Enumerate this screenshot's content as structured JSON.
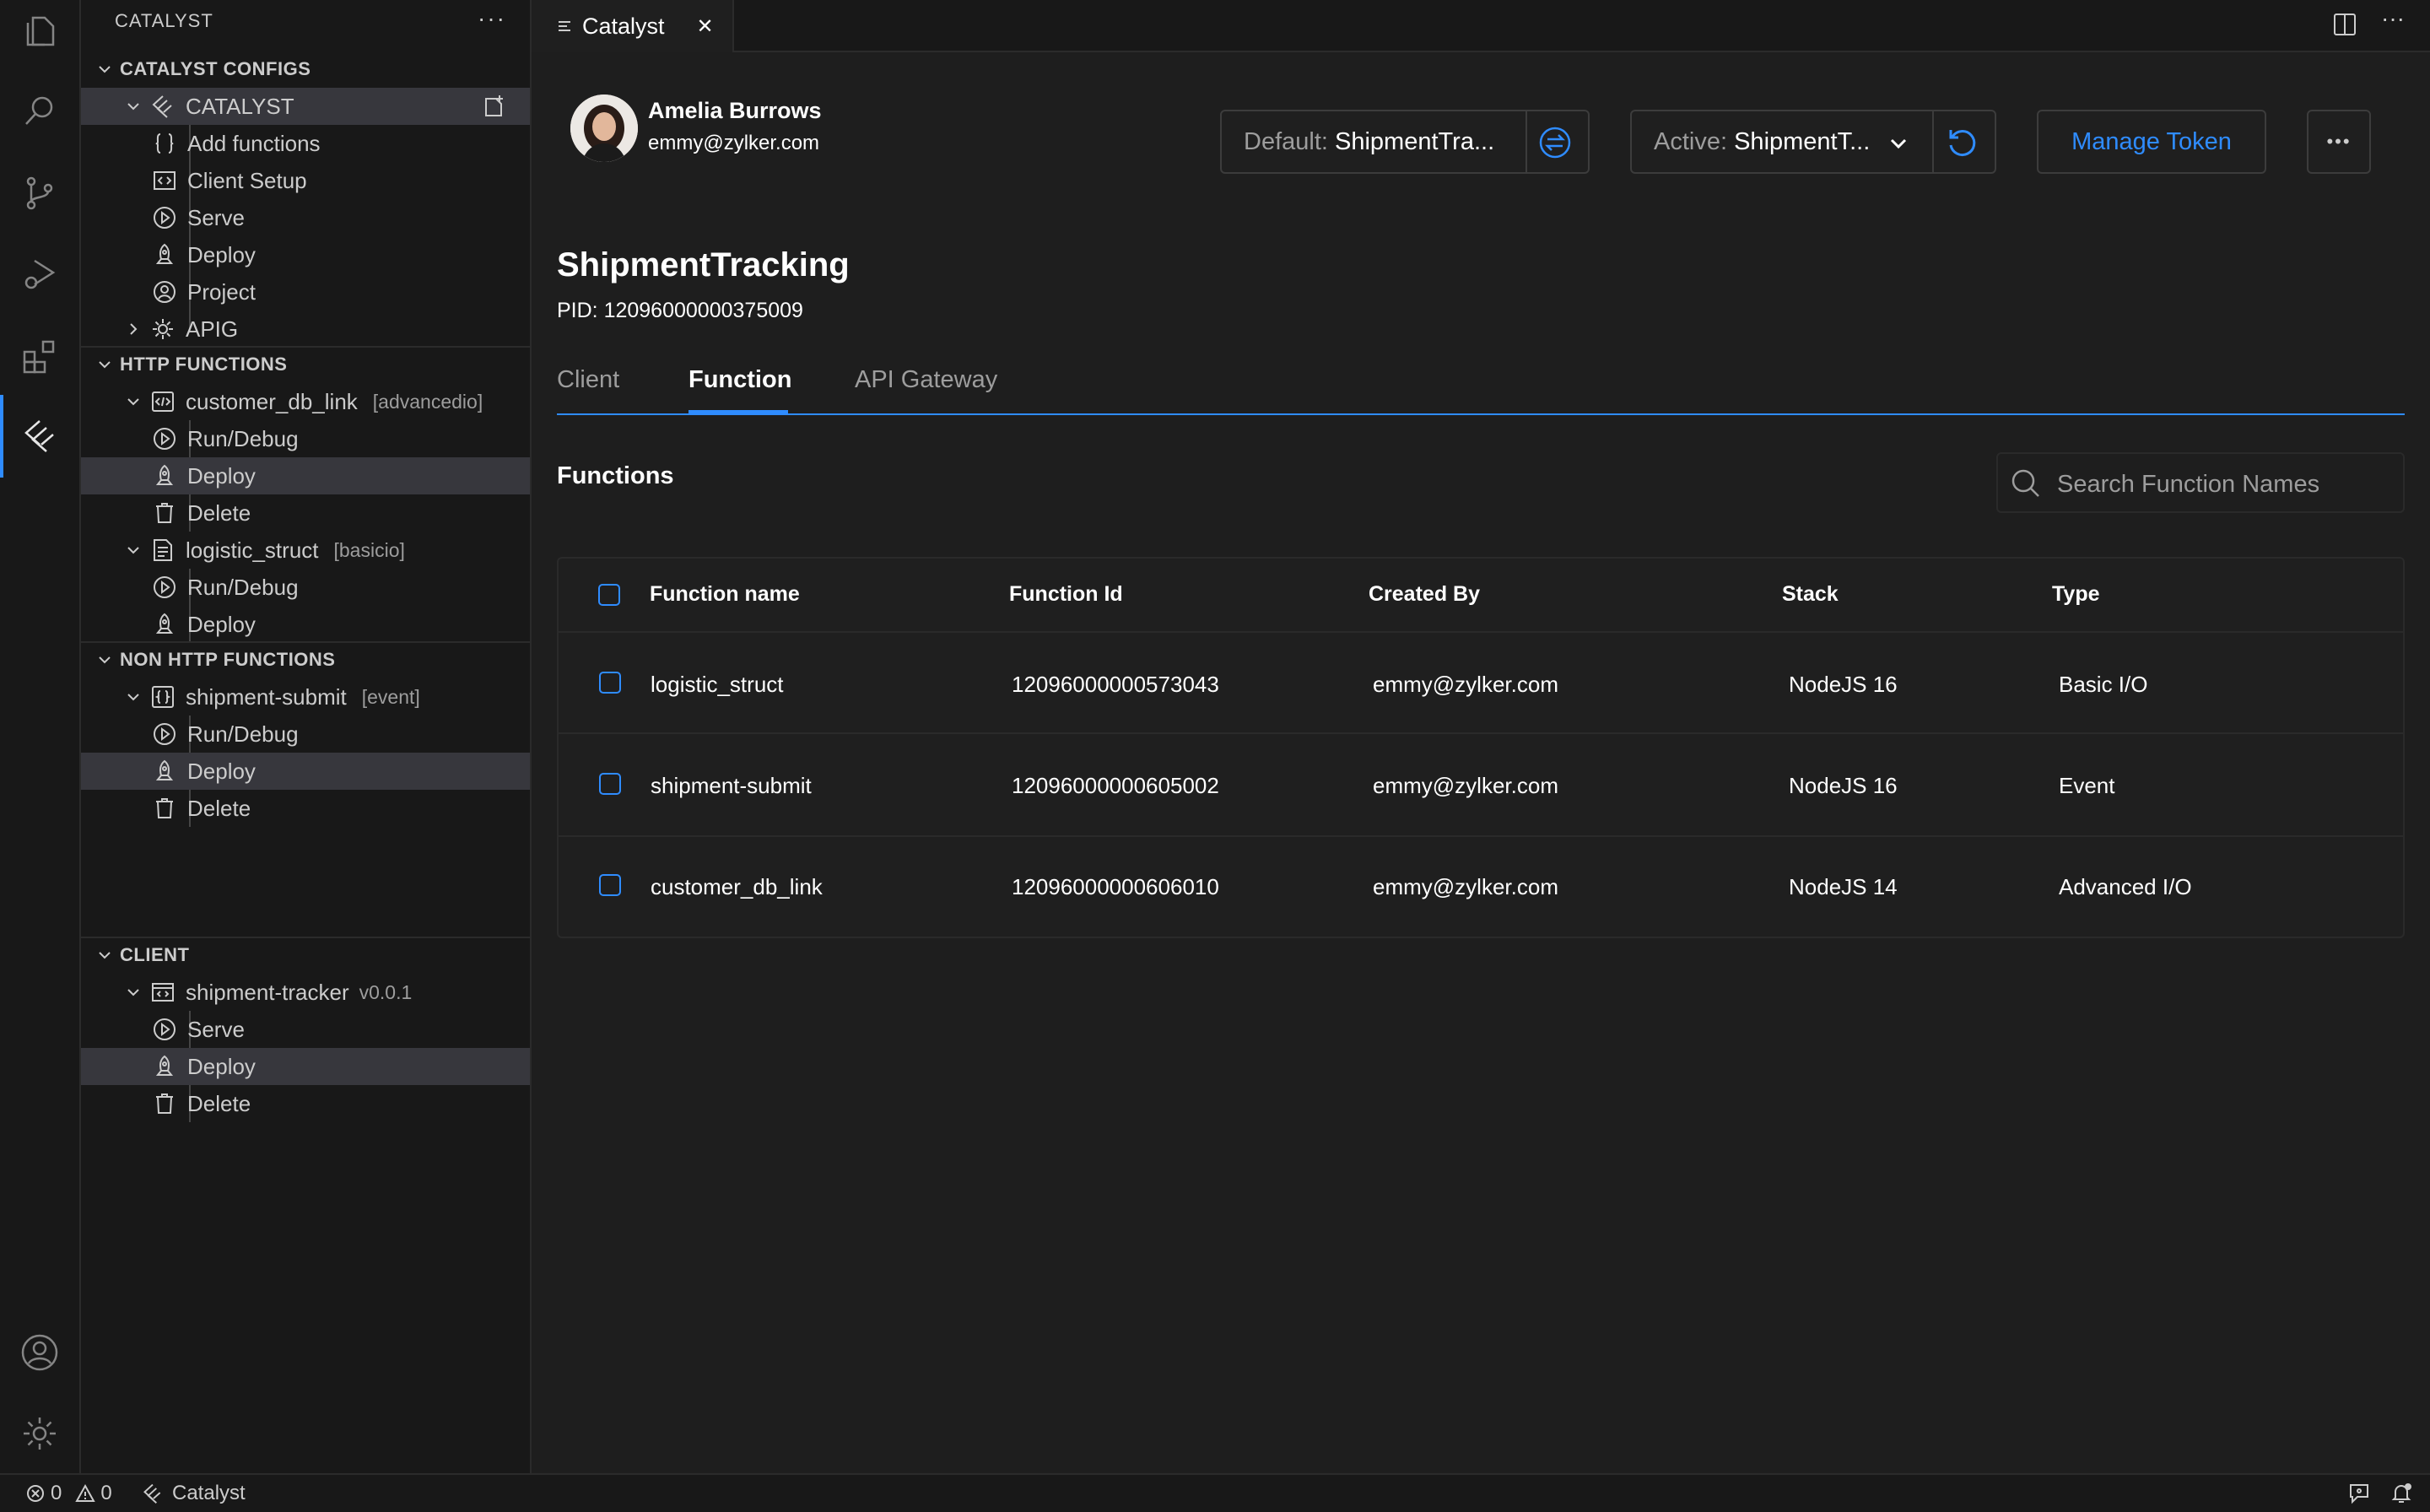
{
  "sidebar": {
    "title": "CATALYST",
    "more": "···",
    "sections": {
      "configs": "CATALYST CONFIGS",
      "http": "HTTP FUNCTIONS",
      "nonhttp": "NON HTTP FUNCTIONS",
      "client": "CLIENT"
    },
    "configs": {
      "root": "CATALYST",
      "add_functions": "Add functions",
      "client_setup": "Client Setup",
      "serve": "Serve",
      "deploy": "Deploy",
      "project": "Project",
      "apig": "APIG"
    },
    "http": {
      "fn1": {
        "name": "customer_db_link",
        "tag": "[advancedio]",
        "run": "Run/Debug",
        "deploy": "Deploy",
        "delete": "Delete"
      },
      "fn2": {
        "name": "logistic_struct",
        "tag": "[basicio]",
        "run": "Run/Debug",
        "deploy": "Deploy"
      }
    },
    "nonhttp": {
      "fn1": {
        "name": "shipment-submit",
        "tag": "[event]",
        "run": "Run/Debug",
        "deploy": "Deploy",
        "delete": "Delete"
      }
    },
    "client": {
      "app": {
        "name": "shipment-tracker",
        "tag": "v0.0.1",
        "serve": "Serve",
        "deploy": "Deploy",
        "delete": "Delete"
      }
    }
  },
  "tab": {
    "label": "Catalyst",
    "close": "✕"
  },
  "user": {
    "name": "Amelia Burrows",
    "email": "emmy@zylker.com"
  },
  "header": {
    "default_label": "Default:",
    "default_value": "ShipmentTra...",
    "active_label": "Active:",
    "active_value": "ShipmentT...",
    "manage_token": "Manage Token",
    "more": "•••"
  },
  "project": {
    "title": "ShipmentTracking",
    "pid": "PID: 12096000000375009"
  },
  "tabs": {
    "client": "Client",
    "function": "Function",
    "api_gateway": "API Gateway"
  },
  "functions": {
    "heading": "Functions",
    "search_placeholder": "Search Function Names",
    "columns": {
      "name": "Function name",
      "id": "Function Id",
      "created_by": "Created By",
      "stack": "Stack",
      "type": "Type"
    },
    "rows": [
      {
        "name": "logistic_struct",
        "id": "12096000000573043",
        "created_by": "emmy@zylker.com",
        "stack": "NodeJS 16",
        "type": "Basic I/O"
      },
      {
        "name": "shipment-submit",
        "id": "12096000000605002",
        "created_by": "emmy@zylker.com",
        "stack": "NodeJS 16",
        "type": "Event"
      },
      {
        "name": "customer_db_link",
        "id": "12096000000606010",
        "created_by": "emmy@zylker.com",
        "stack": "NodeJS 14",
        "type": "Advanced I/O"
      }
    ]
  },
  "status": {
    "errors": "0",
    "warnings": "0",
    "label": "Catalyst"
  },
  "colors": {
    "accent": "#2f8cff",
    "background": "#1e1e1e",
    "sidebar": "#181818",
    "selection": "#37373d"
  }
}
